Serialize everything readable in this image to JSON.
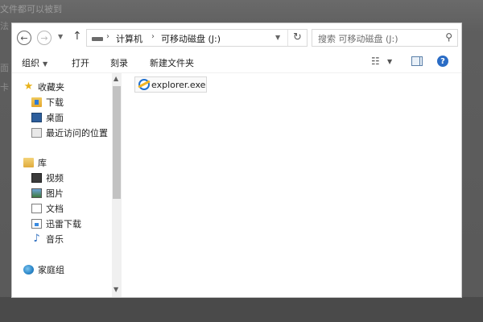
{
  "background": {
    "line1": "文件都可以被到",
    "line2": "法",
    "line3": "面",
    "line4": "卡"
  },
  "window": {
    "address": {
      "breadcrumb": [
        "计算机",
        "可移动磁盘 (J:)"
      ],
      "separator": "›"
    },
    "search": {
      "placeholder": "搜索 可移动磁盘 (J:)"
    },
    "toolbar": {
      "organize": "组织",
      "open": "打开",
      "burn": "刻录",
      "new_folder": "新建文件夹"
    },
    "nav_pane": {
      "favorites": {
        "label": "收藏夹",
        "items": [
          "下载",
          "桌面",
          "最近访问的位置"
        ]
      },
      "libraries": {
        "label": "库",
        "items": [
          "视频",
          "图片",
          "文档",
          "迅雷下载",
          "音乐"
        ]
      },
      "homegroup": {
        "label": "家庭组"
      }
    },
    "content": {
      "files": [
        {
          "name": "explorer.exe",
          "icon": "internet-explorer-icon"
        }
      ]
    }
  },
  "colors": {
    "help_icon": "#2a6cc5",
    "scroll_thumb": "#c2c2c2",
    "desktop_icon": "#2d5e9c"
  }
}
